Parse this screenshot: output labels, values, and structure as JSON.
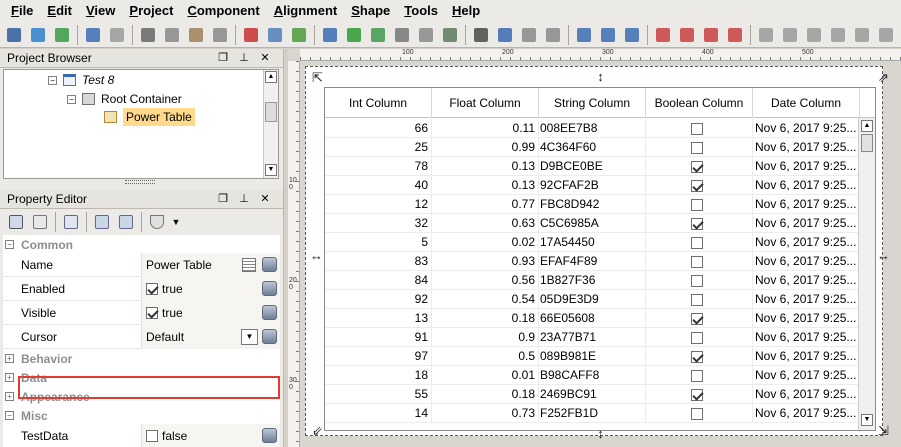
{
  "menu": [
    "File",
    "Edit",
    "View",
    "Project",
    "Component",
    "Alignment",
    "Shape",
    "Tools",
    "Help"
  ],
  "project_browser": {
    "title": "Project Browser",
    "items": [
      {
        "label": "Test 8"
      },
      {
        "label": "Root Container"
      },
      {
        "label": "Power Table"
      }
    ]
  },
  "property_editor": {
    "title": "Property Editor",
    "categories": {
      "common": "Common",
      "behavior": "Behavior",
      "data": "Data",
      "appearance": "Appearance",
      "misc": "Misc"
    },
    "props": {
      "name": {
        "label": "Name",
        "value": "Power Table"
      },
      "enabled": {
        "label": "Enabled",
        "value": "true"
      },
      "visible": {
        "label": "Visible",
        "value": "true"
      },
      "cursor": {
        "label": "Cursor",
        "value": "Default"
      },
      "testdata": {
        "label": "TestData",
        "value": "false"
      }
    }
  },
  "ruler": {
    "h": [
      "100",
      "200",
      "300",
      "400",
      "500"
    ],
    "v": [
      "100",
      "200",
      "300"
    ]
  },
  "table": {
    "headers": [
      "Int Column",
      "Float Column",
      "String Column",
      "Boolean Column",
      "Date Column"
    ],
    "rows": [
      [
        "66",
        "0.11",
        "008EE7B8",
        false,
        "Nov 6, 2017 9:25..."
      ],
      [
        "25",
        "0.99",
        "4C364F60",
        false,
        "Nov 6, 2017 9:25..."
      ],
      [
        "78",
        "0.13",
        "D9BCE0BE",
        true,
        "Nov 6, 2017 9:25..."
      ],
      [
        "40",
        "0.13",
        "92CFAF2B",
        true,
        "Nov 6, 2017 9:25..."
      ],
      [
        "12",
        "0.77",
        "FBC8D942",
        false,
        "Nov 6, 2017 9:25..."
      ],
      [
        "32",
        "0.63",
        "C5C6985A",
        true,
        "Nov 6, 2017 9:25..."
      ],
      [
        "5",
        "0.02",
        "17A54450",
        false,
        "Nov 6, 2017 9:25..."
      ],
      [
        "83",
        "0.93",
        "EFAF4F89",
        false,
        "Nov 6, 2017 9:25..."
      ],
      [
        "84",
        "0.56",
        "1B827F36",
        false,
        "Nov 6, 2017 9:25..."
      ],
      [
        "92",
        "0.54",
        "05D9E3D9",
        false,
        "Nov 6, 2017 9:25..."
      ],
      [
        "13",
        "0.18",
        "66E05608",
        true,
        "Nov 6, 2017 9:25..."
      ],
      [
        "91",
        "0.9",
        "23A77B71",
        false,
        "Nov 6, 2017 9:25..."
      ],
      [
        "97",
        "0.5",
        "089B981E",
        true,
        "Nov 6, 2017 9:25..."
      ],
      [
        "18",
        "0.01",
        "B98CAFF8",
        false,
        "Nov 6, 2017 9:25..."
      ],
      [
        "55",
        "0.18",
        "2469BC91",
        true,
        "Nov 6, 2017 9:25..."
      ],
      [
        "14",
        "0.73",
        "F252FB1D",
        false,
        "Nov 6, 2017 9:25..."
      ]
    ]
  },
  "colors": {
    "highlight": "#e03c31",
    "selection": "#ffd98c"
  }
}
